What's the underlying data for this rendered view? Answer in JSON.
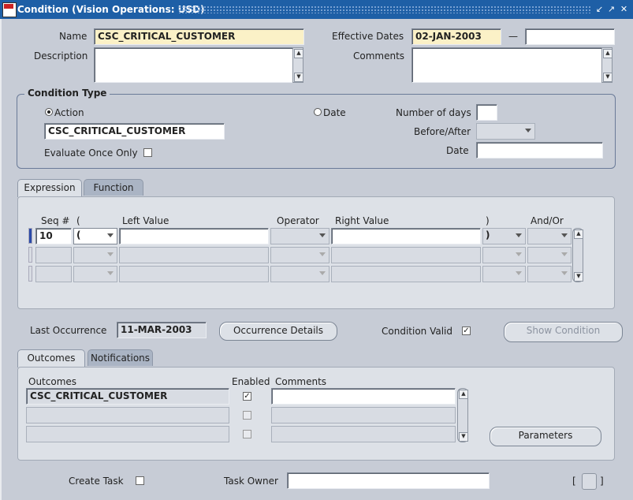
{
  "window": {
    "title": "Condition (Vision Operations: USD)"
  },
  "header": {
    "name_label": "Name",
    "name_value": "CSC_CRITICAL_CUSTOMER",
    "description_label": "Description",
    "description_value": "",
    "effective_dates_label": "Effective Dates",
    "effective_from": "02-JAN-2003",
    "effective_dash": "—",
    "effective_to": "",
    "comments_label": "Comments",
    "comments_value": ""
  },
  "condition_type": {
    "title": "Condition Type",
    "action_label": "Action",
    "action_selected": true,
    "action_value": "CSC_CRITICAL_CUSTOMER",
    "evaluate_once_label": "Evaluate Once Only",
    "date_label": "Date",
    "num_days_label": "Number of days",
    "num_days_value": "",
    "before_after_label": "Before/After",
    "before_after_value": "",
    "date2_label": "Date",
    "date2_value": ""
  },
  "expression_tabs": {
    "tabs": [
      {
        "label": "Expression"
      },
      {
        "label": "Function"
      }
    ]
  },
  "expression": {
    "headers": {
      "seq": "Seq #",
      "lparen": "(",
      "left": "Left Value",
      "op": "Operator",
      "right": "Right Value",
      "rparen": ")",
      "andor": "And/Or"
    },
    "rows": [
      {
        "seq": "10",
        "lparen": "(",
        "left": "",
        "op": "",
        "right": "",
        "rparen": ")",
        "andor": ""
      },
      {
        "seq": "",
        "lparen": "",
        "left": "",
        "op": "",
        "right": "",
        "rparen": "",
        "andor": ""
      },
      {
        "seq": "",
        "lparen": "",
        "left": "",
        "op": "",
        "right": "",
        "rparen": "",
        "andor": ""
      }
    ]
  },
  "occurrence": {
    "last_label": "Last Occurrence",
    "last_value": "11-MAR-2003",
    "details_button": "Occurrence Details",
    "valid_label": "Condition Valid",
    "valid_checked": true,
    "show_button": "Show Condition"
  },
  "outcome_tabs": {
    "tabs": [
      {
        "label": "Outcomes"
      },
      {
        "label": "Notifications"
      }
    ]
  },
  "outcomes": {
    "headers": {
      "outcome": "Outcomes",
      "enabled": "Enabled",
      "comments": "Comments"
    },
    "rows": [
      {
        "outcome": "CSC_CRITICAL_CUSTOMER",
        "enabled": true,
        "comments": ""
      },
      {
        "outcome": "",
        "enabled": false,
        "comments": ""
      },
      {
        "outcome": "",
        "enabled": false,
        "comments": ""
      }
    ],
    "parameters_button": "Parameters"
  },
  "footer": {
    "create_task_label": "Create Task",
    "task_owner_label": "Task Owner",
    "task_owner_value": "",
    "bracket_left": "[",
    "bracket_right": "]"
  },
  "colors": {
    "titlebar": "#1e5fa6",
    "background": "#c7ccd6",
    "required": "#fbf1c7"
  }
}
